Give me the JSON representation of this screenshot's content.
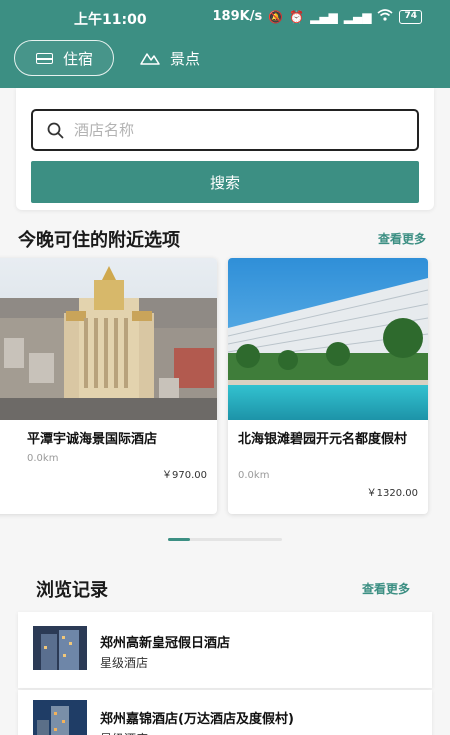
{
  "status_bar": {
    "time": "上午11:00",
    "network_speed": "189K/s",
    "battery": "74"
  },
  "tabs": [
    {
      "label": "住宿",
      "icon": "bed-icon",
      "active": true
    },
    {
      "label": "景点",
      "icon": "mountain-icon",
      "active": false
    }
  ],
  "search": {
    "placeholder": "酒店名称",
    "value": "",
    "button_label": "搜索"
  },
  "nearby": {
    "title": "今晚可住的附近选项",
    "more_label": "查看更多",
    "hotels": [
      {
        "name": "平潭宇诚海景国际酒店",
        "distance": "0.0km",
        "price": "￥970.00"
      },
      {
        "name": "北海银滩碧园开元名都度假村",
        "distance": "0.0km",
        "price": "￥1320.00"
      }
    ],
    "pager_position": 0.0
  },
  "history": {
    "title": "浏览记录",
    "more_label": "查看更多",
    "items": [
      {
        "name": "郑州高新皇冠假日酒店",
        "type": "星级酒店"
      },
      {
        "name": "郑州嘉锦酒店(万达酒店及度假村)",
        "type": "星级酒店"
      }
    ]
  },
  "colors": {
    "accent": "#3c8f83",
    "background": "#f6f6f6"
  }
}
